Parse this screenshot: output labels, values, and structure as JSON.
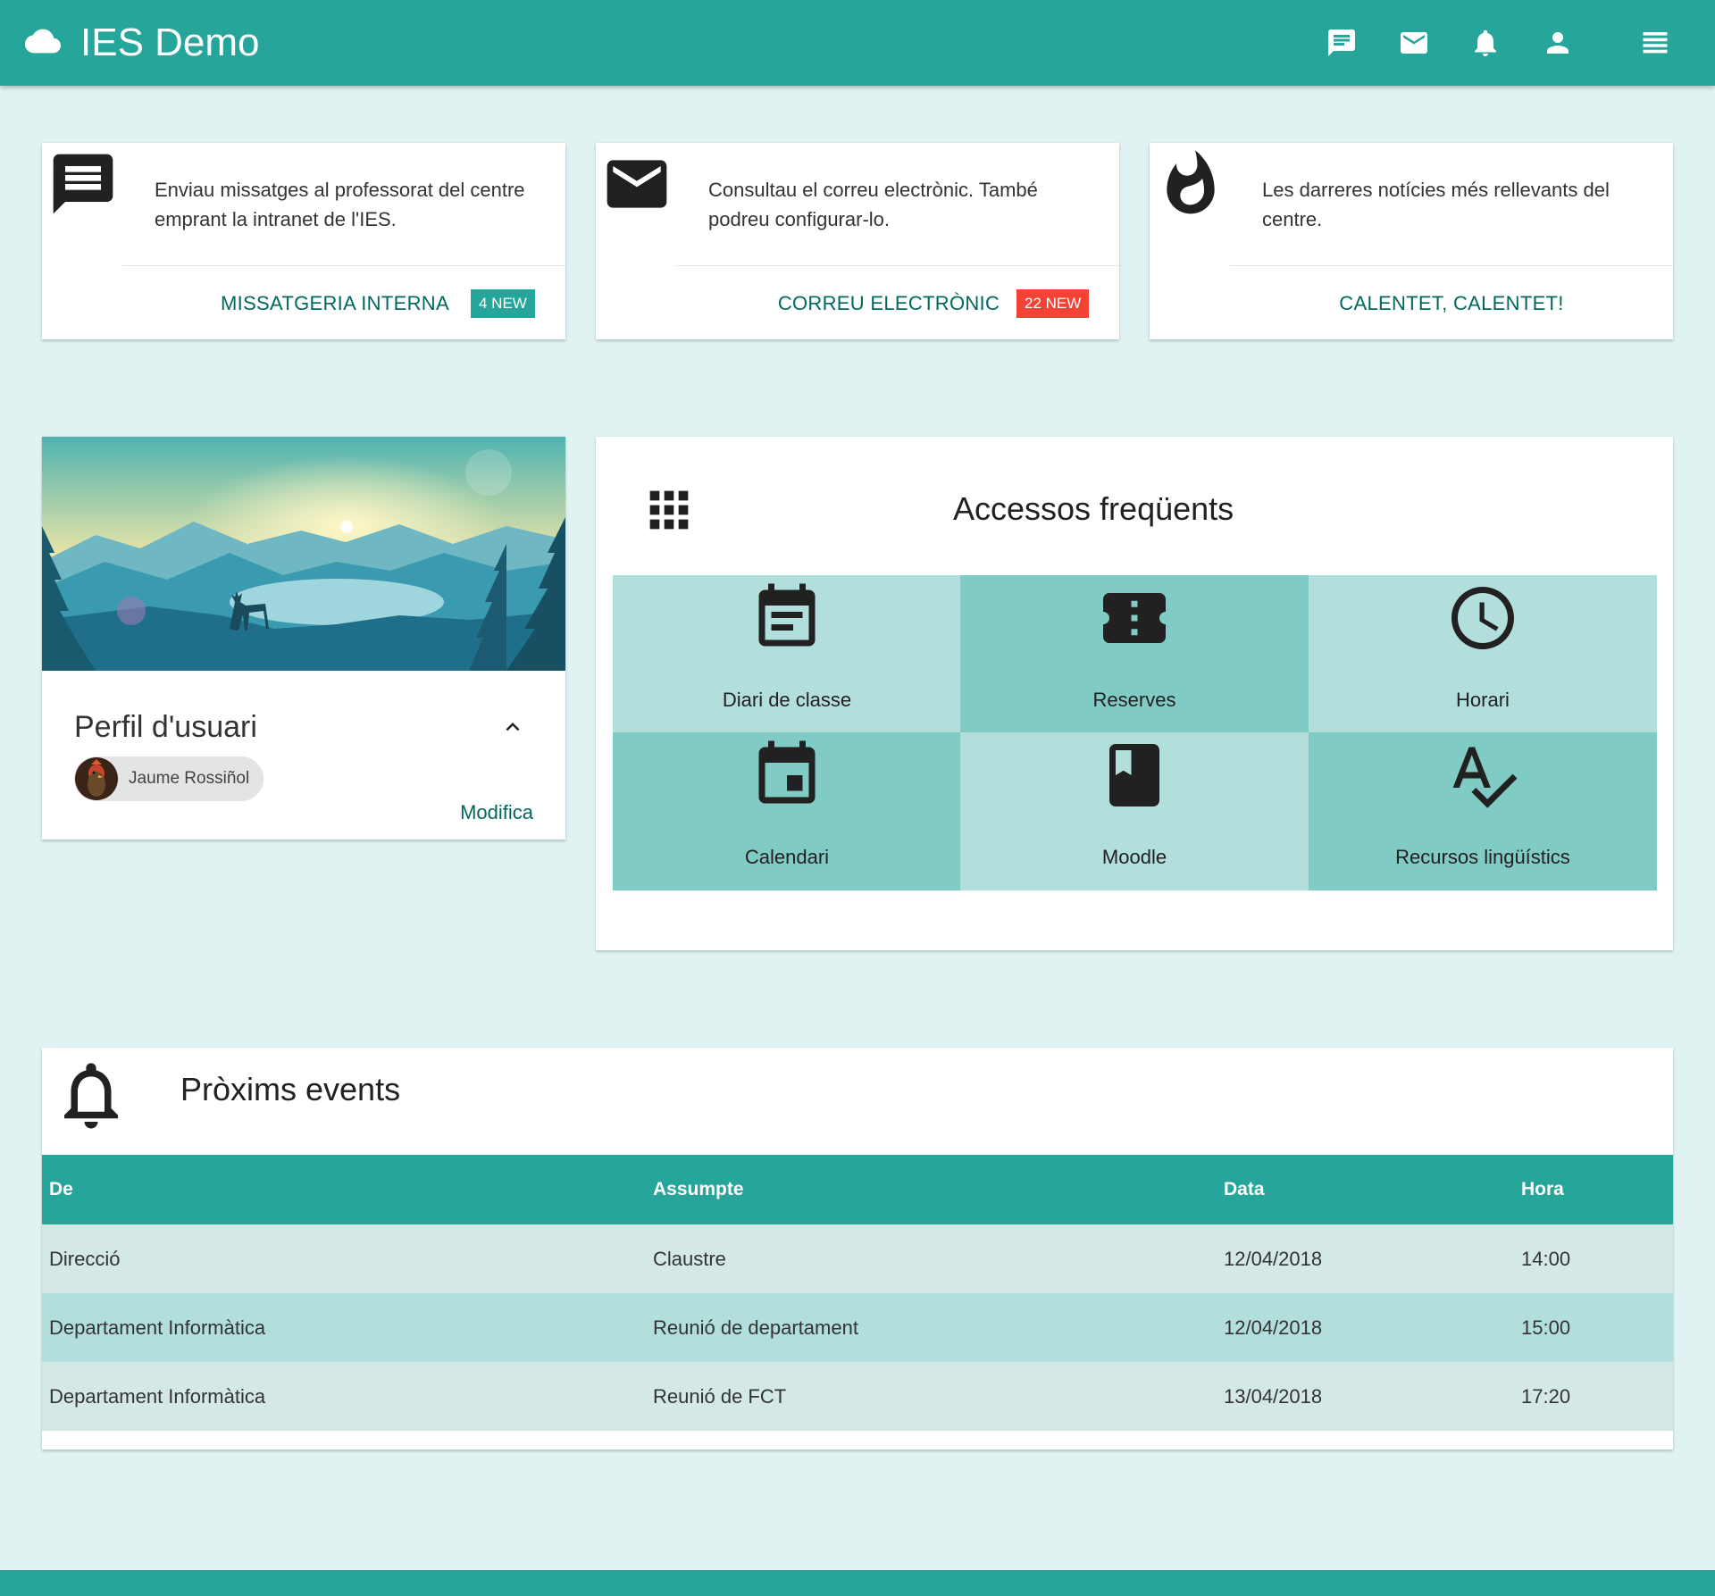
{
  "app": {
    "title": "IES Demo",
    "brand_icon": "cloud-icon"
  },
  "topnav": [
    {
      "name": "chat-icon"
    },
    {
      "name": "mail-icon"
    },
    {
      "name": "bell-icon"
    },
    {
      "name": "person-icon"
    },
    {
      "name": "menu-icon"
    }
  ],
  "cards": [
    {
      "icon": "message-icon",
      "text": "Enviau missatges al professorat del centre emprant la intranet de l'IES.",
      "link": "MISSATGERIA INTERNA",
      "badge": "4 NEW",
      "badge_color": "#26a69a"
    },
    {
      "icon": "mail-icon",
      "text": "Consultau el correu electrònic. També podreu configurar-lo.",
      "link": "CORREU ELECTRÒNIC",
      "badge": "22 NEW",
      "badge_color": "#f44336"
    },
    {
      "icon": "fire-icon",
      "text": "Les darreres notícies més rellevants del centre.",
      "link": "CALENTET, CALENTET!"
    }
  ],
  "profile": {
    "title": "Perfil d'usuari",
    "user_name": "Jaume Rossiñol",
    "edit_label": "Modifica"
  },
  "access": {
    "title": "Accessos freqüents",
    "tiles": [
      {
        "label": "Diari de classe",
        "icon": "event-note-icon"
      },
      {
        "label": "Reserves",
        "icon": "ticket-icon"
      },
      {
        "label": "Horari",
        "icon": "clock-icon"
      },
      {
        "label": "Calendari",
        "icon": "calendar-icon"
      },
      {
        "label": "Moodle",
        "icon": "book-icon"
      },
      {
        "label": "Recursos lingüístics",
        "icon": "spellcheck-icon"
      }
    ]
  },
  "events": {
    "title": "Pròxims events",
    "columns": [
      "De",
      "Assumpte",
      "Data",
      "Hora"
    ],
    "rows": [
      [
        "Direcció",
        "Claustre",
        "12/04/2018",
        "14:00"
      ],
      [
        "Departament Informàtica",
        "Reunió de departament",
        "12/04/2018",
        "15:00"
      ],
      [
        "Departament Informàtica",
        "Reunió de FCT",
        "13/04/2018",
        "17:20"
      ]
    ]
  },
  "colors": {
    "primary": "#26a69a",
    "background": "#e0f2f1",
    "link": "#00695c",
    "tile_light": "#b2dfdb",
    "tile_dark": "#80cbc4",
    "badge_red": "#f44336"
  }
}
